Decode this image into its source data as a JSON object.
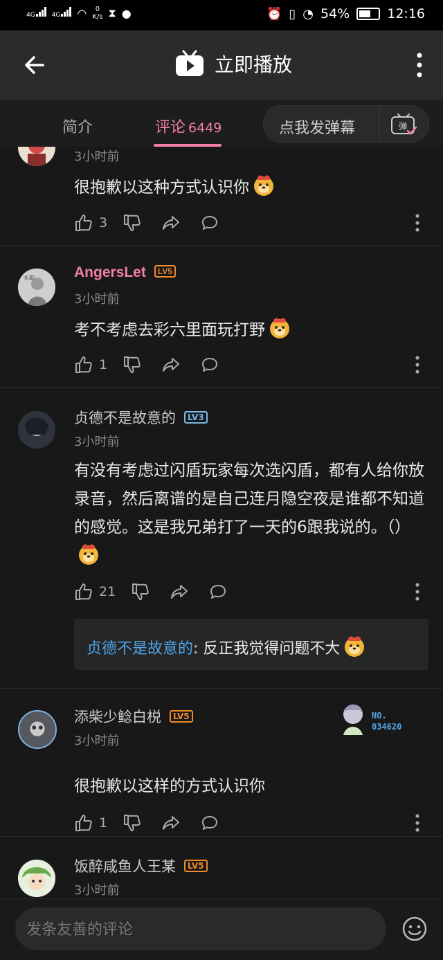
{
  "status_bar": {
    "net1": "4G",
    "net2": "4G",
    "speed_top": "0",
    "speed_unit": "K/s",
    "battery": "54%",
    "time": "12:16"
  },
  "header": {
    "title": "立即播放"
  },
  "tabs": [
    {
      "label": "简介"
    },
    {
      "label": "评论",
      "count": "6449"
    }
  ],
  "danmaku": {
    "label": "点我发弹幕",
    "icon_char": "弹"
  },
  "comments": [
    {
      "time": "3小时前",
      "text": "很抱歉以这种方式认识你",
      "likes": "3"
    },
    {
      "username": "AngersLet",
      "level": "LV5",
      "time": "3小时前",
      "text": "考不考虑去彩六里面玩打野",
      "likes": "1"
    },
    {
      "username": "贞德不是故意的",
      "level": "LV3",
      "time": "3小时前",
      "text": "有没有考虑过闪盾玩家每次选闪盾，都有人给你放录音，然后离谱的是自己连月隐空夜是谁都不知道的感觉。这是我兄弟打了一天的6跟我说的。（）",
      "likes": "21",
      "reply": {
        "name": "贞德不是故意的",
        "text": ": 反正我觉得问题不大"
      }
    },
    {
      "username": "添柴少鲶白棁",
      "level": "LV5",
      "time": "3小时前",
      "text": "很抱歉以这样的方式认识你",
      "likes": "1",
      "badge_no": "NO.",
      "badge_num": "034620"
    },
    {
      "username": "饭醉咸鱼人王某",
      "level": "LV5",
      "time": "3小时前"
    }
  ],
  "composer": {
    "placeholder": "发条友善的评论"
  },
  "colors": {
    "accent_pink": "#f47fa6",
    "level5": "#f08a2c",
    "level3": "#77b8e6",
    "reply_name": "#4da3e6"
  }
}
